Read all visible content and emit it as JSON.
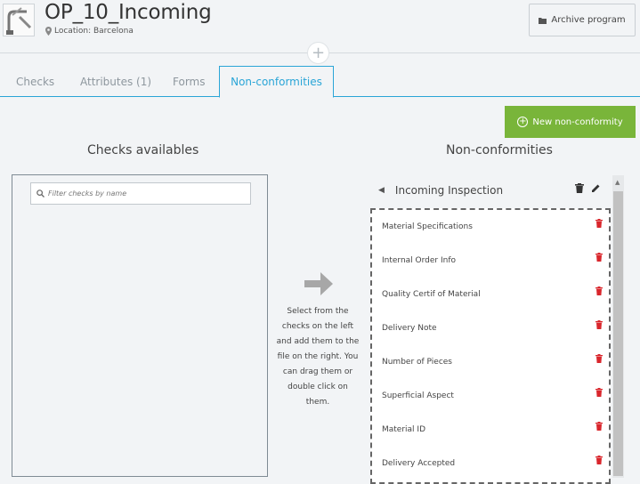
{
  "header": {
    "title": "OP_10_Incoming",
    "location": "Location: Barcelona",
    "archive_label": "Archive program",
    "logo_icon": "faucet-image",
    "archive_icon": "folder-icon",
    "location_icon": "map-pin-icon",
    "add_icon": "plus-icon"
  },
  "tabs": [
    {
      "label": "Checks",
      "active": false
    },
    {
      "label": "Attributes (1)",
      "active": false
    },
    {
      "label": "Forms",
      "active": false
    },
    {
      "label": "Non-conformities",
      "active": true
    }
  ],
  "new_button": {
    "label": "New non-conformity",
    "icon": "plus-circle-icon"
  },
  "left": {
    "title": "Checks availables",
    "search_placeholder": "Filter checks by name",
    "search_icon": "search-icon"
  },
  "middle": {
    "arrow_icon": "arrow-right-icon",
    "instructions": "Select from the checks on the left and add them to the file on the right. You can drag them or double click on them."
  },
  "right": {
    "title": "Non-conformities",
    "group_name": "Incoming Inspection",
    "items": [
      "Material Specifications",
      "Internal Order Info",
      "Quality Certif of Material",
      "Delivery Note",
      "Number of Pieces",
      "Superficial Aspect",
      "Material ID",
      "Delivery Accepted"
    ]
  },
  "colors": {
    "accent": "#2aa5d7",
    "new_button": "#79b53a",
    "trash": "#d9262c"
  }
}
